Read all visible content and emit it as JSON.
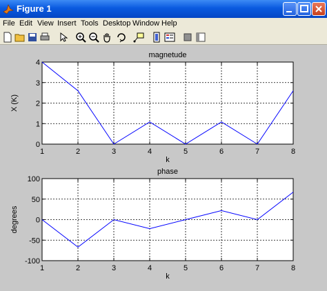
{
  "window": {
    "title": "Figure 1"
  },
  "menu": [
    "File",
    "Edit",
    "View",
    "Insert",
    "Tools",
    "Desktop",
    "Window",
    "Help"
  ],
  "toolbar_icons": [
    "new-file-icon",
    "open-folder-icon",
    "save-icon",
    "print-icon",
    "pointer-icon",
    "zoom-in-icon",
    "zoom-out-icon",
    "pan-hand-icon",
    "rotate-3d-icon",
    "data-cursor-icon",
    "colorbar-icon",
    "legend-icon",
    "hide-plot-tools-icon",
    "show-plot-tools-icon"
  ],
  "chart_data": [
    {
      "type": "line",
      "title": "magnetude",
      "xlabel": "k",
      "ylabel": "X (K)",
      "x": [
        1,
        2,
        3,
        4,
        5,
        6,
        7,
        8
      ],
      "series": [
        {
          "values": [
            4,
            2.6,
            0,
            1.08,
            0,
            1.08,
            0,
            2.6
          ]
        }
      ],
      "xlim": [
        1,
        8
      ],
      "ylim": [
        0,
        4
      ],
      "xticks": [
        1,
        2,
        3,
        4,
        5,
        6,
        7,
        8
      ],
      "yticks": [
        0,
        1,
        2,
        3,
        4
      ],
      "grid": true,
      "line_color": "#0000ff"
    },
    {
      "type": "line",
      "title": "phase",
      "xlabel": "k",
      "ylabel": "degrees",
      "x": [
        1,
        2,
        3,
        4,
        5,
        6,
        7,
        8
      ],
      "series": [
        {
          "values": [
            0,
            -67,
            0,
            -22,
            0,
            22,
            0,
            67
          ]
        }
      ],
      "xlim": [
        1,
        8
      ],
      "ylim": [
        -100,
        100
      ],
      "xticks": [
        1,
        2,
        3,
        4,
        5,
        6,
        7,
        8
      ],
      "yticks": [
        -100,
        -50,
        0,
        50,
        100
      ],
      "grid": true,
      "line_color": "#0000ff"
    }
  ]
}
